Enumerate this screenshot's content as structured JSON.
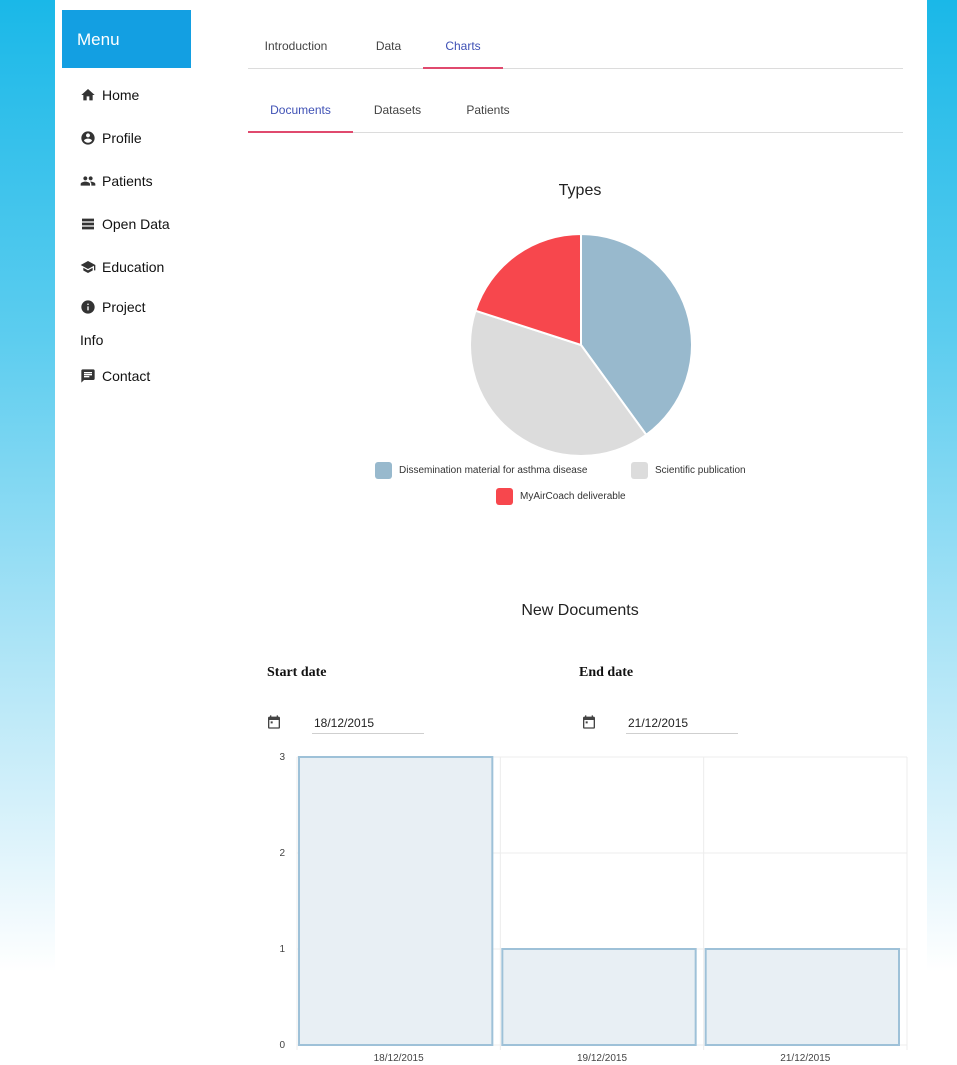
{
  "sidebar": {
    "menu_title": "Menu",
    "items": [
      {
        "label": "Home",
        "icon": "home-icon"
      },
      {
        "label": "Profile",
        "icon": "account-circle-icon"
      },
      {
        "label": "Patients",
        "icon": "people-icon"
      },
      {
        "label": "Open Data",
        "icon": "list-icon"
      },
      {
        "label": "Education",
        "icon": "school-icon"
      },
      {
        "label": "Project",
        "label2": "Info",
        "icon": "info-icon"
      },
      {
        "label": "Contact",
        "icon": "message-icon"
      }
    ]
  },
  "top_tabs": [
    {
      "label": "Introduction",
      "active": false
    },
    {
      "label": "Data",
      "active": false
    },
    {
      "label": "Charts",
      "active": true
    }
  ],
  "sub_tabs": [
    {
      "label": "Documents",
      "active": true
    },
    {
      "label": "Datasets",
      "active": false
    },
    {
      "label": "Patients",
      "active": false
    }
  ],
  "pie_section": {
    "title": "Types"
  },
  "bar_section": {
    "title": "New Documents",
    "start_label": "Start date",
    "end_label": "End date",
    "start_value": "18/12/2015",
    "end_value": "21/12/2015"
  },
  "colors": {
    "menu_header": "#139fe2",
    "active_tab_text": "#3f51b5",
    "active_tab_underline": "#e04a6e",
    "bar_fill": "#e8eff4",
    "bar_stroke": "#9ec1d8"
  },
  "chart_data": [
    {
      "type": "pie",
      "title": "Types",
      "categories": [
        "Dissemination material for asthma disease",
        "Scientific publication",
        "MyAirCoach deliverable"
      ],
      "values": [
        2,
        2,
        1
      ],
      "colors": [
        "#98b9cd",
        "#dcdcdc",
        "#f7474d"
      ],
      "legend": "bottom"
    },
    {
      "type": "bar",
      "title": "New Documents",
      "categories": [
        "18/12/2015",
        "19/12/2015",
        "21/12/2015"
      ],
      "values": [
        3,
        1,
        1
      ],
      "ylim": [
        0,
        3
      ],
      "yticks": [
        0,
        1,
        2,
        3
      ],
      "grid": true
    }
  ]
}
